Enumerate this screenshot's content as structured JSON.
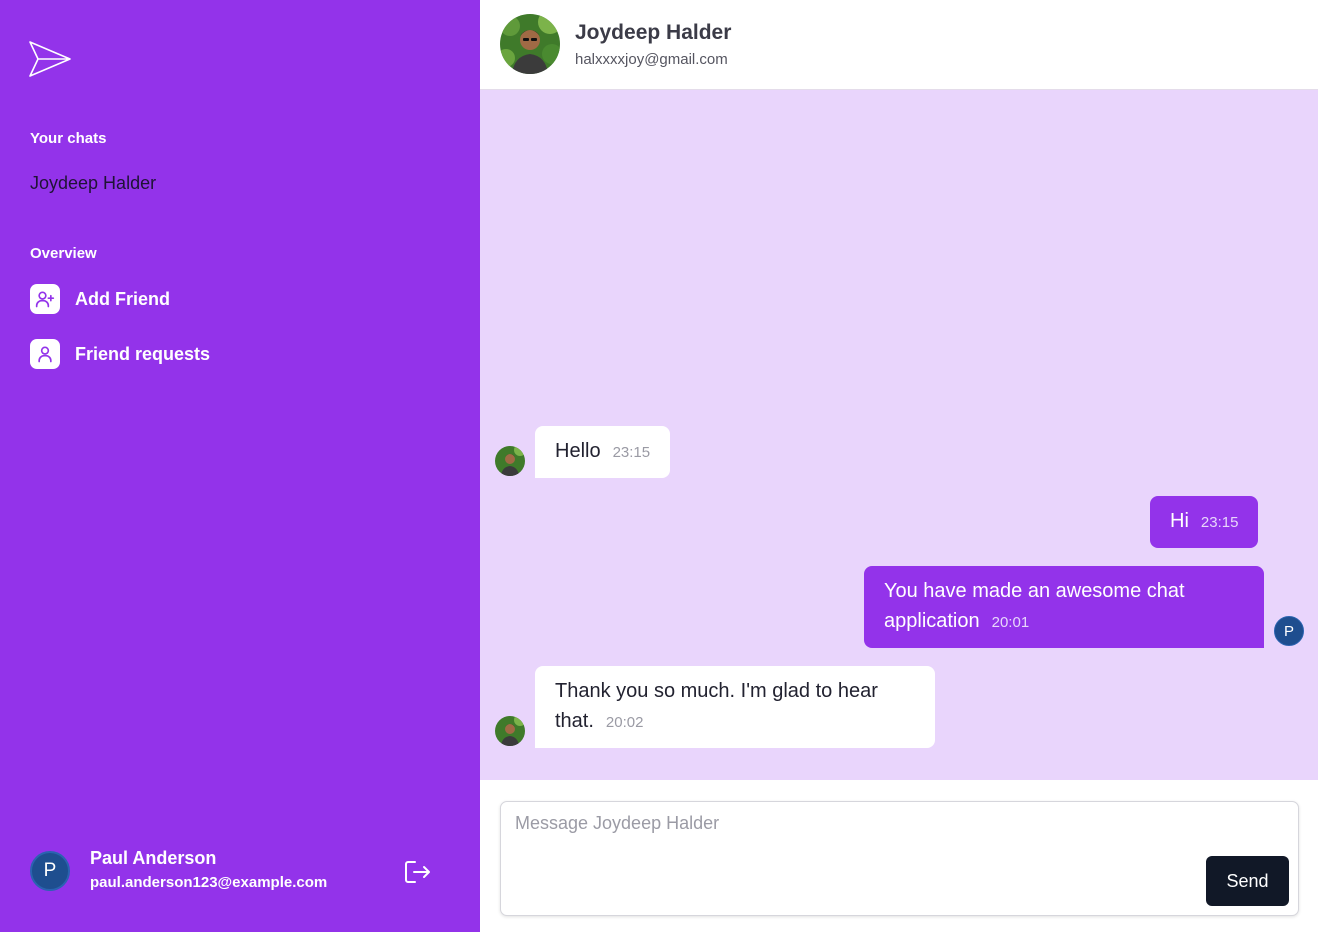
{
  "sidebar": {
    "logo_icon": "paper-plane-icon",
    "chats_title": "Your chats",
    "chats": [
      "Joydeep Halder"
    ],
    "overview_title": "Overview",
    "nav": [
      {
        "label": "Add Friend",
        "icon": "user-plus-icon"
      },
      {
        "label": "Friend requests",
        "icon": "user-icon"
      }
    ],
    "user": {
      "initial": "P",
      "name": "Paul Anderson",
      "email": "paul.anderson123@example.com"
    },
    "logout_icon": "logout-icon"
  },
  "header": {
    "name": "Joydeep Halder",
    "email": "halxxxxjoy@gmail.com"
  },
  "messages": [
    {
      "direction": "in",
      "text": "Hello",
      "time": "23:15"
    },
    {
      "direction": "out",
      "text": "Hi",
      "time": "23:15"
    },
    {
      "direction": "out",
      "text": "You have made an awesome chat application",
      "time": "20:01"
    },
    {
      "direction": "in",
      "text": "Thank you so much. I'm glad to hear that.",
      "time": "20:02"
    }
  ],
  "composer": {
    "placeholder": "Message Joydeep Halder",
    "value": "",
    "send_label": "Send"
  },
  "colors": {
    "sidebar_bg": "#9333ea",
    "chat_bg": "#e9d5fc",
    "outgoing_bubble": "#9333ea",
    "incoming_bubble": "#ffffff",
    "send_button": "#111827"
  }
}
